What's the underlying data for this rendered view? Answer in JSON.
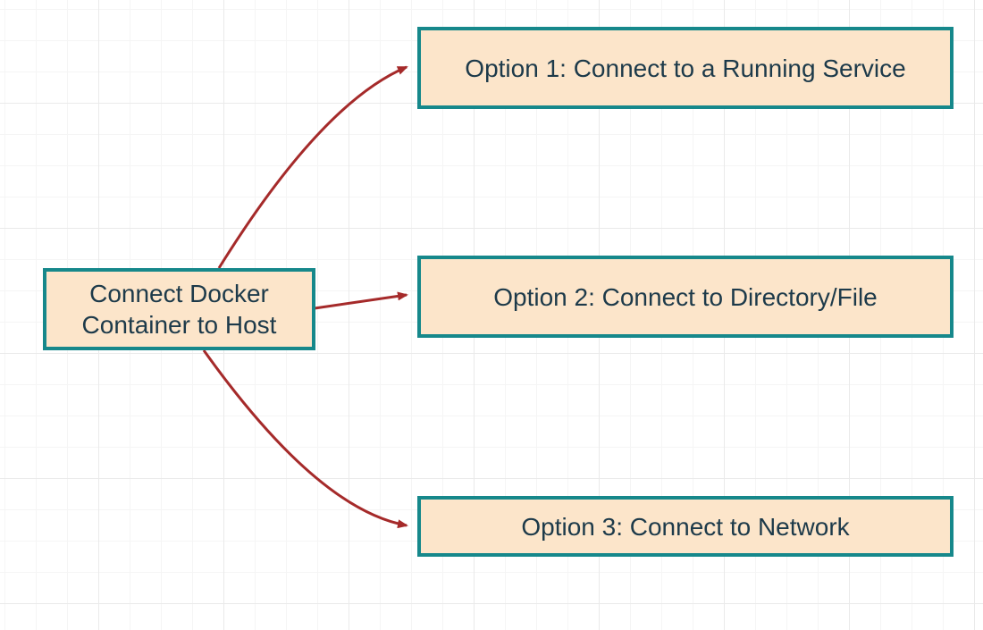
{
  "diagram": {
    "root": {
      "label": "Connect Docker Container to Host"
    },
    "option1": {
      "label": "Option 1: Connect to a Running Service"
    },
    "option2": {
      "label": "Option 2: Connect to Directory/File"
    },
    "option3": {
      "label": "Option 3: Connect to Network"
    }
  },
  "style": {
    "node_border": "#16888b",
    "node_fill": "#fce5ca",
    "node_text": "#1d3a4a",
    "arrow_color": "#a52a2a"
  }
}
